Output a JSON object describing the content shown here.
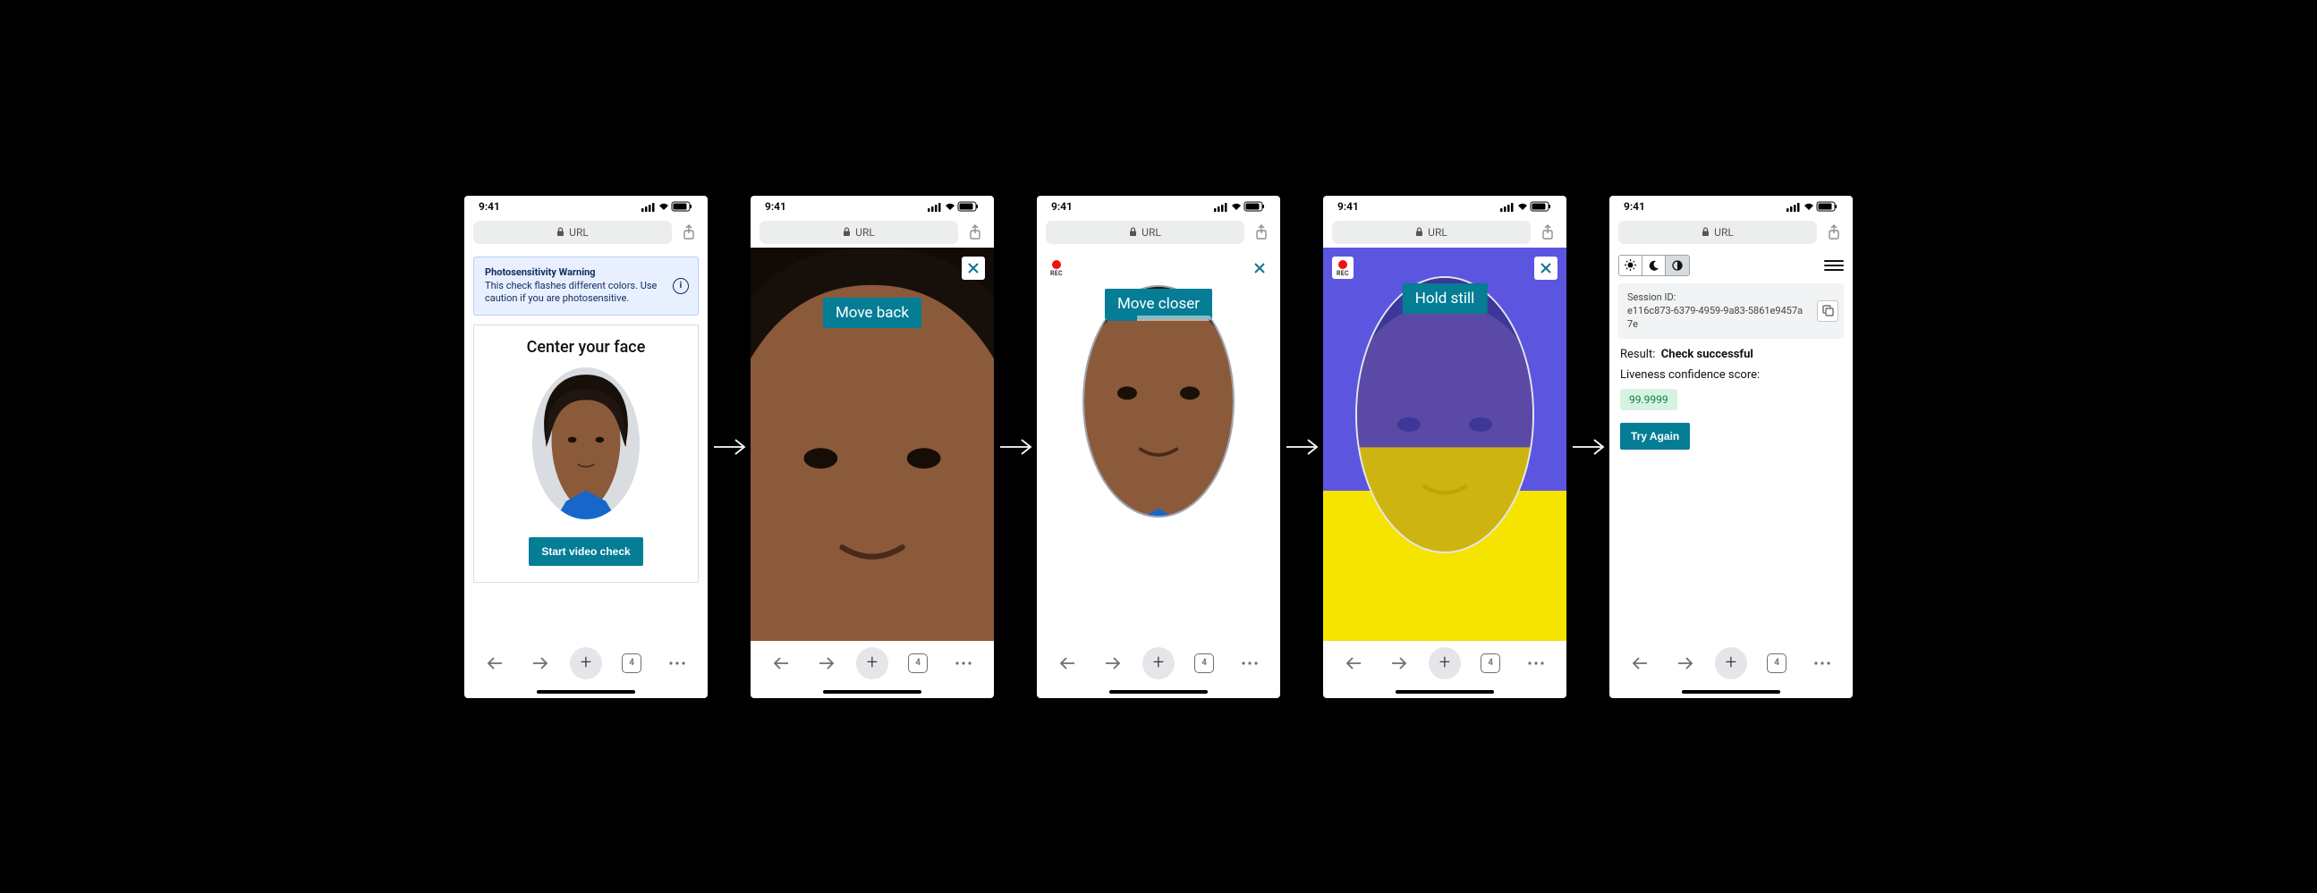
{
  "statusbar": {
    "time": "9:41"
  },
  "urlbar": {
    "label": "URL"
  },
  "bottomnav": {
    "tab_count": "4"
  },
  "frames": {
    "f1": {
      "warning_title": "Photosensitivity Warning",
      "warning_body": "This check flashes different colors. Use caution if you are photosensitive.",
      "heading": "Center your face",
      "start_button": "Start video check"
    },
    "f2": {
      "hint": "Move back"
    },
    "f3": {
      "hint": "Move closer",
      "rec": "REC"
    },
    "f4": {
      "hint": "Hold still",
      "rec": "REC"
    },
    "f5": {
      "session_label": "Session ID:",
      "session_id": "e116c873-6379-4959-9a83-5861e9457a7e",
      "result_label": "Result:",
      "result_value": "Check successful",
      "score_label": "Liveness confidence score:",
      "score_value": "99.9999",
      "try_again": "Try Again"
    }
  }
}
